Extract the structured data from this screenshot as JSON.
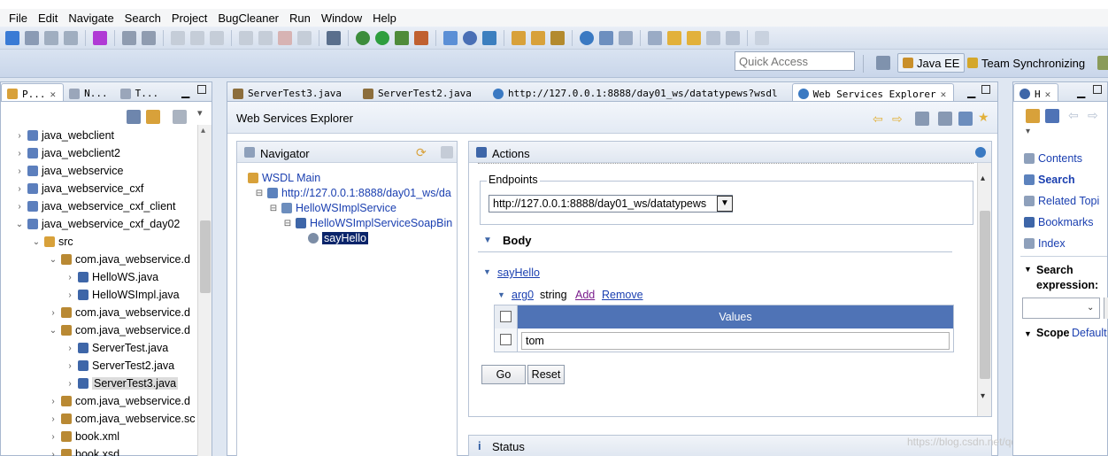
{
  "menu": [
    "File",
    "Edit",
    "Navigate",
    "Search",
    "Project",
    "BugCleaner",
    "Run",
    "Window",
    "Help"
  ],
  "quick_access": {
    "placeholder": "Quick Access"
  },
  "perspectives": {
    "java_ee": "Java EE",
    "team_sync": "Team Synchronizing"
  },
  "left_tabs": [
    "P...",
    "N...",
    "T..."
  ],
  "project_tree": [
    {
      "label": "java_webclient",
      "indent": 0,
      "expanded": false
    },
    {
      "label": "java_webclient2",
      "indent": 0,
      "expanded": false
    },
    {
      "label": "java_webservice",
      "indent": 0,
      "expanded": false
    },
    {
      "label": "java_webservice_cxf",
      "indent": 0,
      "expanded": false
    },
    {
      "label": "java_webservice_cxf_client",
      "indent": 0,
      "expanded": false
    },
    {
      "label": "java_webservice_cxf_day02",
      "indent": 0,
      "expanded": true
    },
    {
      "label": "src",
      "indent": 1,
      "expanded": true
    },
    {
      "label": "com.java_webservice.d",
      "indent": 2,
      "expanded": true
    },
    {
      "label": "HelloWS.java",
      "indent": 3,
      "expanded": false
    },
    {
      "label": "HelloWSImpl.java",
      "indent": 3,
      "expanded": false
    },
    {
      "label": "com.java_webservice.d",
      "indent": 2,
      "expanded": false
    },
    {
      "label": "com.java_webservice.d",
      "indent": 2,
      "expanded": true
    },
    {
      "label": "ServerTest.java",
      "indent": 3,
      "expanded": false
    },
    {
      "label": "ServerTest2.java",
      "indent": 3,
      "expanded": false
    },
    {
      "label": "ServerTest3.java",
      "indent": 3,
      "expanded": false
    },
    {
      "label": "com.java_webservice.d",
      "indent": 2,
      "expanded": false
    },
    {
      "label": "com.java_webservice.sc",
      "indent": 2,
      "expanded": false
    },
    {
      "label": "book.xml",
      "indent": 2,
      "expanded": false
    },
    {
      "label": "book.xsd",
      "indent": 2,
      "expanded": false
    }
  ],
  "editor_tabs": [
    {
      "label": "ServerTest3.java"
    },
    {
      "label": "ServerTest2.java"
    },
    {
      "label": "http://127.0.0.1:8888/day01_ws/datatypews?wsdl"
    },
    {
      "label": "Web Services Explorer"
    }
  ],
  "wse": {
    "title": "Web Services Explorer",
    "navigator": {
      "title": "Navigator",
      "root": "WSDL Main",
      "url": "http://127.0.0.1:8888/day01_ws/da",
      "service": "HelloWSImplService",
      "binding": "HelloWSImplServiceSoapBin",
      "operation": "sayHello"
    },
    "actions": {
      "title": "Actions",
      "endpoints_label": "Endpoints",
      "endpoint_value": "http://127.0.0.1:8888/day01_ws/datatypews",
      "body_label": "Body",
      "operation": "sayHello",
      "arg": "arg0",
      "arg_type": "string",
      "add": "Add",
      "remove": "Remove",
      "values_header": "Values",
      "value": "tom",
      "go": "Go",
      "reset": "Reset"
    },
    "status": {
      "title": "Status"
    }
  },
  "help": {
    "tab": "H",
    "items": [
      "Contents",
      "Search",
      "Related Topi",
      "Bookmarks",
      "Index"
    ],
    "search_expression": "Search expression:",
    "scope_label": "Scope",
    "scope_value": "Default"
  },
  "watermark": "https://blog.csdn.net/qq_27922171",
  "colors": {
    "accent": "#1a3fb0",
    "highlight": "#e642e6",
    "values_header": "#4f73b6"
  }
}
